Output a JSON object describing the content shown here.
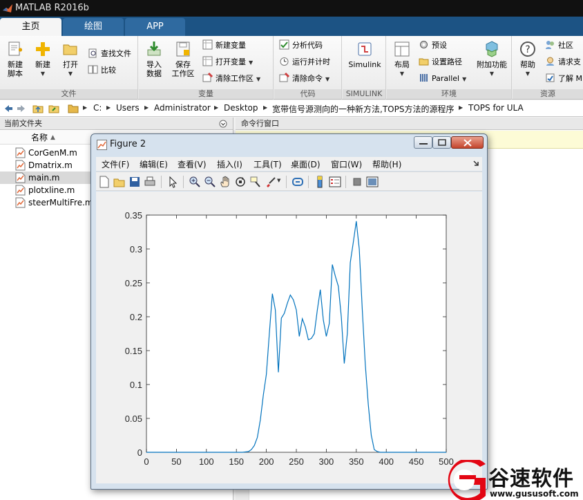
{
  "app": {
    "title": "MATLAB R2016b"
  },
  "tabs": [
    "主页",
    "绘图",
    "APP"
  ],
  "ribbon": {
    "file": {
      "label": "文件",
      "new_script": "新建\n脚本",
      "new": "新建",
      "open": "打开",
      "find_files": "查找文件",
      "compare": "比较"
    },
    "variable": {
      "label": "变量",
      "import": "导入\n数据",
      "save_ws": "保存\n工作区",
      "new_var": "新建变量",
      "open_var": "打开变量",
      "clear_ws": "清除工作区"
    },
    "code": {
      "label": "代码",
      "analyze": "分析代码",
      "run_time": "运行并计时",
      "clear_cmds": "清除命令"
    },
    "simulink": {
      "label": "SIMULINK",
      "btn": "Simulink"
    },
    "env": {
      "label": "环境",
      "layout": "布局",
      "prefs": "预设",
      "set_path": "设置路径",
      "parallel": "Parallel",
      "addons": "附加功能"
    },
    "resources": {
      "label": "资源",
      "help": "帮助",
      "community": "社区",
      "request": "请求支",
      "learn": "了解 M"
    }
  },
  "address": {
    "crumbs": [
      "C:",
      "Users",
      "Administrator",
      "Desktop",
      "宽带信号源测向的一种新方法,TOPS方法的源程序",
      "TOPS for ULA"
    ]
  },
  "current_folder": {
    "title": "当前文件夹",
    "col_name": "名称",
    "sort_indicator": "▲",
    "files": [
      "CorGenM.m",
      "Dmatrix.m",
      "main.m",
      "plotxline.m",
      "steerMultiFre.m"
    ],
    "selected": "main.m"
  },
  "command_window": {
    "title": "命令行窗口"
  },
  "figure": {
    "title": "Figure 2",
    "menus": [
      "文件(F)",
      "编辑(E)",
      "查看(V)",
      "插入(I)",
      "工具(T)",
      "桌面(D)",
      "窗口(W)",
      "帮助(H)"
    ]
  },
  "chart_data": {
    "type": "line",
    "xlim": [
      0,
      500
    ],
    "ylim": [
      0,
      0.35
    ],
    "xticks": [
      0,
      50,
      100,
      150,
      200,
      250,
      300,
      350,
      400,
      450,
      500
    ],
    "yticks": [
      0,
      0.05,
      0.1,
      0.15,
      0.2,
      0.25,
      0.3,
      0.35
    ],
    "xtick_labels": [
      "0",
      "50",
      "100",
      "150",
      "200",
      "250",
      "300",
      "350",
      "400",
      "450",
      "500"
    ],
    "ytick_labels": [
      "0",
      "0.05",
      "0.1",
      "0.15",
      "0.2",
      "0.25",
      "0.3",
      "0.35"
    ],
    "grid": false,
    "color": "#0072bd",
    "x": [
      0,
      160,
      170,
      175,
      180,
      185,
      190,
      195,
      200,
      205,
      210,
      215,
      220,
      225,
      230,
      235,
      240,
      245,
      250,
      255,
      260,
      265,
      270,
      275,
      280,
      285,
      290,
      295,
      300,
      305,
      310,
      315,
      320,
      325,
      330,
      335,
      340,
      345,
      350,
      355,
      360,
      365,
      370,
      375,
      380,
      385,
      390,
      395,
      400,
      405,
      410,
      420,
      500
    ],
    "y": [
      0,
      0,
      0.001,
      0.004,
      0.01,
      0.022,
      0.048,
      0.085,
      0.115,
      0.175,
      0.234,
      0.21,
      0.118,
      0.198,
      0.205,
      0.22,
      0.232,
      0.225,
      0.21,
      0.171,
      0.197,
      0.185,
      0.166,
      0.168,
      0.175,
      0.21,
      0.24,
      0.195,
      0.171,
      0.19,
      0.277,
      0.26,
      0.245,
      0.2,
      0.131,
      0.175,
      0.28,
      0.31,
      0.341,
      0.3,
      0.21,
      0.13,
      0.07,
      0.025,
      0.004,
      0.001,
      0,
      0,
      0,
      0,
      0,
      0,
      0
    ]
  },
  "watermark": {
    "brand": "谷速软件",
    "url": "www.gususoft.com"
  },
  "colors": {
    "tab_bar": "#1c5384",
    "line": "#0072bd",
    "watermark_red": "#e30613"
  }
}
